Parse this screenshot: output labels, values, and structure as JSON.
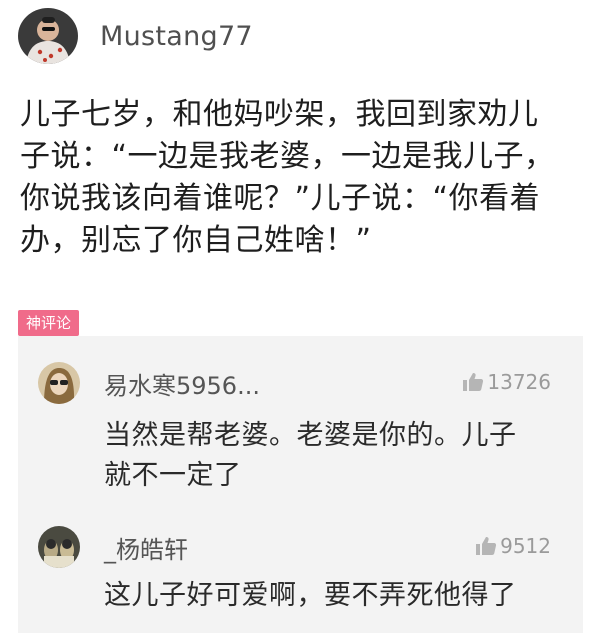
{
  "post": {
    "author": "Mustang77",
    "body": "儿子七岁，和他妈吵架，我回到家劝儿\n子说：“一边是我老婆，一边是我儿子，\n你说我该向着谁呢？”儿子说：“你看着\n办，别忘了你自己姓啥！”"
  },
  "hot_comments": {
    "tag": "神评论",
    "items": [
      {
        "user": "易水寒5956...",
        "likes": "13726",
        "text": "当然是帮老婆。老婆是你的。儿子\n就不一定了"
      },
      {
        "user": "_杨皓轩",
        "likes": "9512",
        "text": "这儿子好可爱啊，要不弄死他得了"
      }
    ]
  },
  "icons": {
    "like": "thumbs-up-icon"
  },
  "colors": {
    "tag_bg": "#f06b8a",
    "panel_bg": "#f3f3f3",
    "muted_text": "#9a9a9a"
  }
}
